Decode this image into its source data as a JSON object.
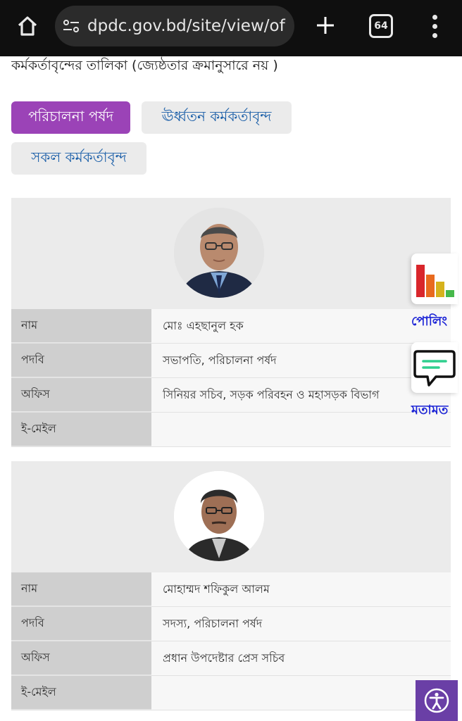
{
  "browser": {
    "url": "dpdc.gov.bd/site/view/of",
    "tab_count": "64"
  },
  "page": {
    "heading": "কর্মকর্তাবৃন্দের তালিকা (জ্যেষ্ঠতার ক্রমানুসারে নয় )"
  },
  "tabs": [
    {
      "label": "পরিচালনা পর্ষদ",
      "active": true
    },
    {
      "label": "ঊর্ধ্বতন কর্মকর্তাবৃন্দ",
      "active": false
    },
    {
      "label": "সকল কর্মকর্তাবৃন্দ",
      "active": false
    }
  ],
  "labels": {
    "name": "নাম",
    "designation": "পদবি",
    "office": "অফিস",
    "email": "ই-মেইল"
  },
  "officials": [
    {
      "name": "মোঃ এহছানুল হক",
      "designation": "সভাপতি, পরিচালনা পর্ষদ",
      "office": "সিনিয়র সচিব, সড়ক পরিবহন ও মহাসড়ক বিভাগ",
      "email": ""
    },
    {
      "name": "মোহাম্মদ শফিকুল আলম",
      "designation": "সদস্য, পরিচালনা পর্ষদ",
      "office": "প্রধান উপদেষ্টার প্রেস সচিব",
      "email": ""
    }
  ],
  "widgets": {
    "poll_label": "পোলিং",
    "feedback_label": "মতামত"
  },
  "colors": {
    "active_tab": "#9b43b7",
    "inactive_tab_text": "#1a5ea8",
    "widget_label": "#1a22d6",
    "a11y_button": "#6a3fa6"
  },
  "icons": {
    "home": "home-icon",
    "site_settings": "site-settings-icon",
    "new_tab": "plus-icon",
    "tabs": "tabs-icon",
    "menu": "more-vert-icon",
    "poll": "bar-chart-icon",
    "feedback": "chat-bubble-icon",
    "accessibility": "accessibility-icon"
  }
}
